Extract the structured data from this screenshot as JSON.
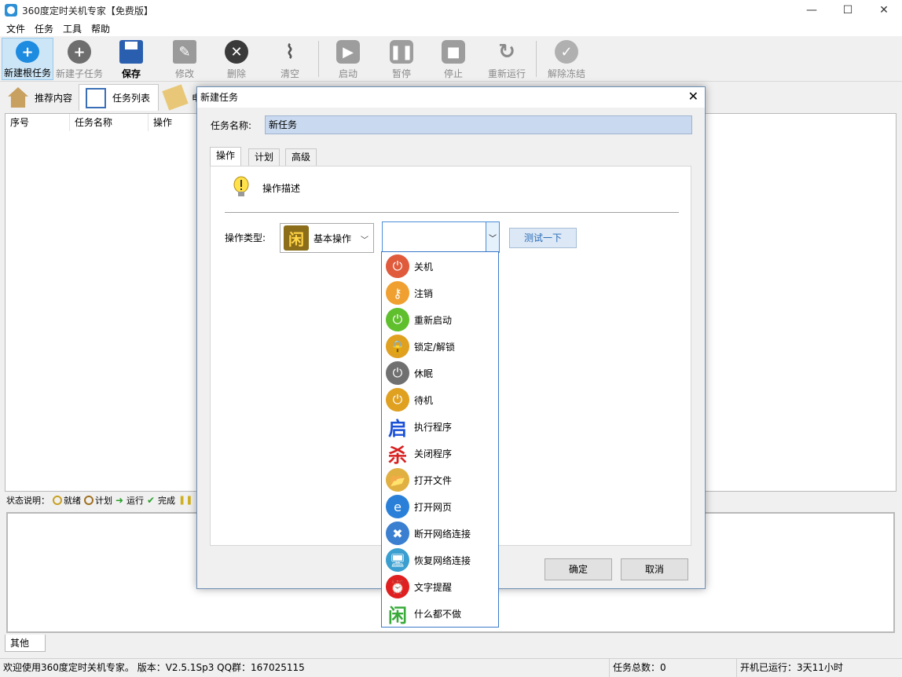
{
  "window": {
    "title": "360度定时关机专家【免费版】",
    "controls": {
      "minimize": "—",
      "maximize": "☐",
      "close": "✕"
    }
  },
  "menu": [
    "文件",
    "任务",
    "工具",
    "帮助"
  ],
  "toolbar": {
    "new_root": "新建根任务",
    "new_child": "新建子任务",
    "save": "保存",
    "edit": "修改",
    "delete": "删除",
    "clear": "清空",
    "start": "启动",
    "pause": "暂停",
    "stop": "停止",
    "rerun": "重新运行",
    "unfreeze": "解除冻结"
  },
  "main_tabs": {
    "recommend": "推荐内容",
    "tasklist": "任务列表",
    "third": "电"
  },
  "columns": {
    "index": "序号",
    "name": "任务名称",
    "action": "操作"
  },
  "legend": {
    "label": "状态说明：",
    "ready": "就绪",
    "plan": "计划",
    "running": "运行",
    "done": "完成"
  },
  "bottom_tab": "其他",
  "statusbar": {
    "welcome": "欢迎使用360度定时关机专家。 版本：V2.5.1Sp3  QQ群：167025115",
    "total": "任务总数：0",
    "uptime": "开机已运行：3天11小时"
  },
  "dialog": {
    "title": "新建任务",
    "close": "✕",
    "name_label": "任务名称:",
    "name_value": "新任务",
    "tabs": [
      "操作",
      "计划",
      "高级"
    ],
    "desc": "操作描述",
    "type_label": "操作类型:",
    "type_value": "基本操作",
    "type_icon_glyph": "闲",
    "test_button": "测试一下",
    "ok": "确定",
    "cancel": "取消"
  },
  "dropdown": [
    {
      "label": "关机",
      "icon": "power-red-icon",
      "glyph": "⏻",
      "color": "#e05a3c"
    },
    {
      "label": "注销",
      "icon": "key-icon",
      "glyph": "⚷",
      "color": "#f0a030"
    },
    {
      "label": "重新启动",
      "icon": "power-green-icon",
      "glyph": "⏻",
      "color": "#5fbf2c"
    },
    {
      "label": "锁定/解锁",
      "icon": "lock-icon",
      "glyph": "🔒",
      "color": "#e0a020"
    },
    {
      "label": "休眠",
      "icon": "power-grey-icon",
      "glyph": "⏻",
      "color": "#707070"
    },
    {
      "label": "待机",
      "icon": "power-yellow-icon",
      "glyph": "⏻",
      "color": "#e0a020"
    },
    {
      "label": "执行程序",
      "icon": "launch-icon",
      "glyph": "启",
      "color": "#1a4fd8"
    },
    {
      "label": "关闭程序",
      "icon": "kill-icon",
      "glyph": "杀",
      "color": "#d82020"
    },
    {
      "label": "打开文件",
      "icon": "folder-icon",
      "glyph": "📂",
      "color": "#e0b040"
    },
    {
      "label": "打开网页",
      "icon": "ie-icon",
      "glyph": "e",
      "color": "#2a80d8"
    },
    {
      "label": "断开网络连接",
      "icon": "network-disconnect-icon",
      "glyph": "✖",
      "color": "#3a7fd0"
    },
    {
      "label": "恢复网络连接",
      "icon": "network-restore-icon",
      "glyph": "🖥",
      "color": "#3a9fd0"
    },
    {
      "label": "文字提醒",
      "icon": "alarm-clock-icon",
      "glyph": "⏰",
      "color": "#e02020"
    },
    {
      "label": "什么都不做",
      "icon": "idle-icon",
      "glyph": "闲",
      "color": "#3aaa3a"
    }
  ]
}
